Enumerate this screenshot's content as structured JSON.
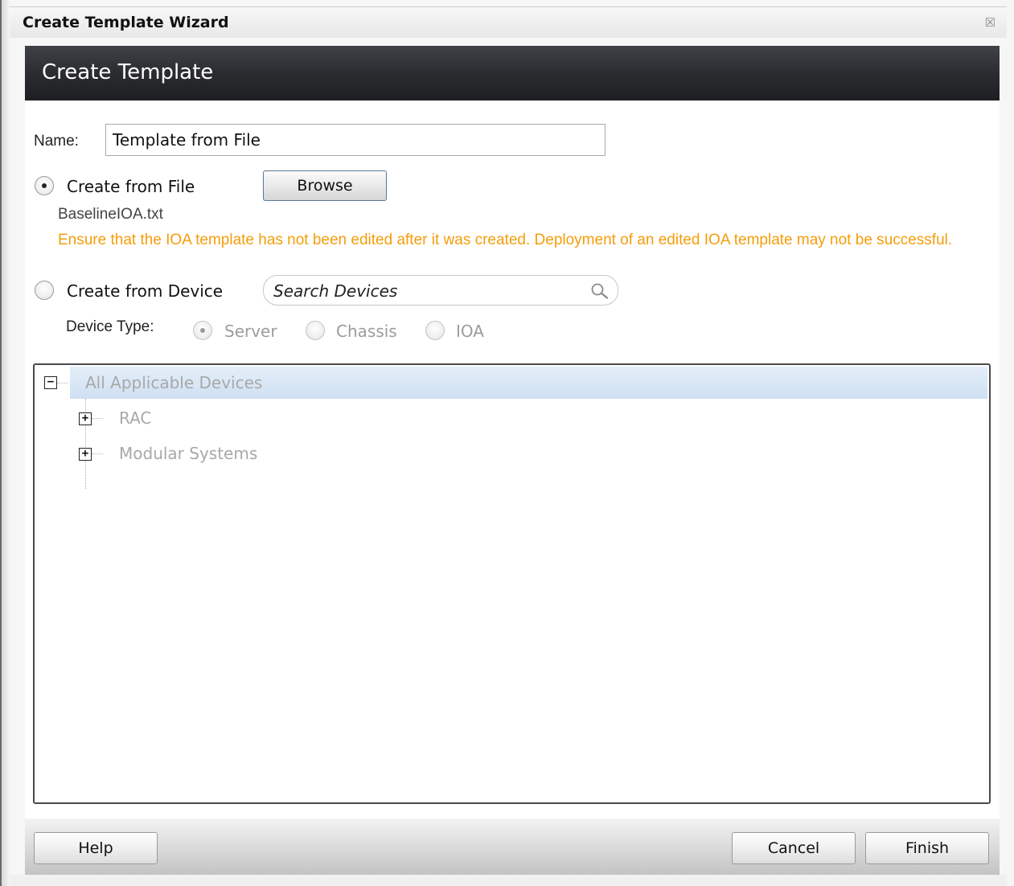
{
  "window": {
    "title": "Create Template Wizard",
    "close_glyph": "☒"
  },
  "banner": {
    "heading": "Create Template"
  },
  "form": {
    "name_label": "Name:",
    "name_value": "Template from File",
    "create_from_file_label": "Create from File",
    "create_from_file_selected": true,
    "browse_label": "Browse",
    "file_name": "BaselineIOA.txt",
    "warning": "Ensure that the IOA template has not been edited after it was created. Deployment of an edited IOA template may not be successful.",
    "warning_color": "#f59d0a",
    "create_from_device_label": "Create from Device",
    "create_from_device_selected": false,
    "search_placeholder": "Search Devices",
    "device_type_label": "Device Type:",
    "device_types": [
      {
        "label": "Server",
        "selected": true
      },
      {
        "label": "Chassis",
        "selected": false
      },
      {
        "label": "IOA",
        "selected": false
      }
    ]
  },
  "tree": {
    "root": {
      "label": "All Applicable Devices",
      "expanded": true
    },
    "children": [
      {
        "label": "RAC",
        "expanded": false
      },
      {
        "label": "Modular Systems",
        "expanded": false
      }
    ],
    "toggle_collapse_glyph": "−",
    "toggle_expand_glyph": "+"
  },
  "footer": {
    "help_label": "Help",
    "cancel_label": "Cancel",
    "finish_label": "Finish"
  }
}
